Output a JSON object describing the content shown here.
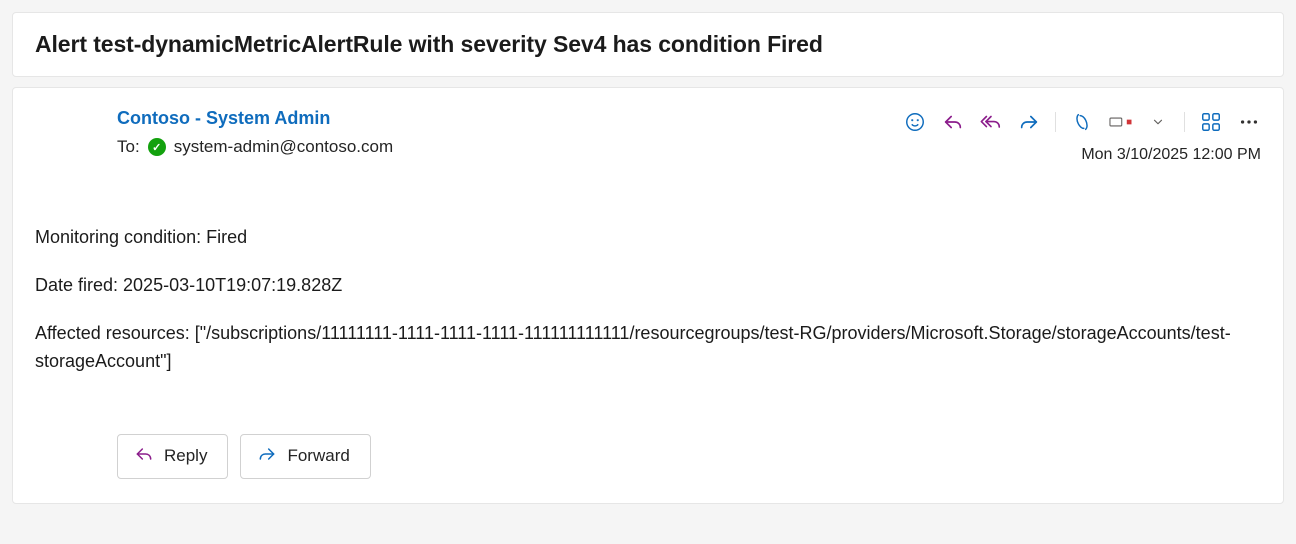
{
  "subject": "Alert test-dynamicMetricAlertRule with severity Sev4 has condition Fired",
  "sender": {
    "name": "Contoso - System Admin"
  },
  "recipient": {
    "to_label": "To:",
    "address": "system-admin@contoso.com"
  },
  "timestamp": "Mon 3/10/2025 12:00 PM",
  "body": {
    "line1": "Monitoring condition: Fired",
    "line2": "Date fired: 2025-03-10T19:07:19.828Z",
    "line3": "Affected resources: [\"/subscriptions/11111111-1111-1111-1111-111111111111/resourcegroups/test-RG/providers/Microsoft.Storage/storageAccounts/test-storageAccount\"]"
  },
  "buttons": {
    "reply": "Reply",
    "forward": "Forward"
  },
  "toolbar": {
    "react": "react-icon",
    "reply": "reply-icon",
    "reply_all": "reply-all-icon",
    "forward": "forward-icon",
    "copilot": "copilot-icon",
    "read_toggle": "read-toggle-icon",
    "chevron": "chevron-down-icon",
    "apps": "apps-icon",
    "more": "more-icon"
  }
}
